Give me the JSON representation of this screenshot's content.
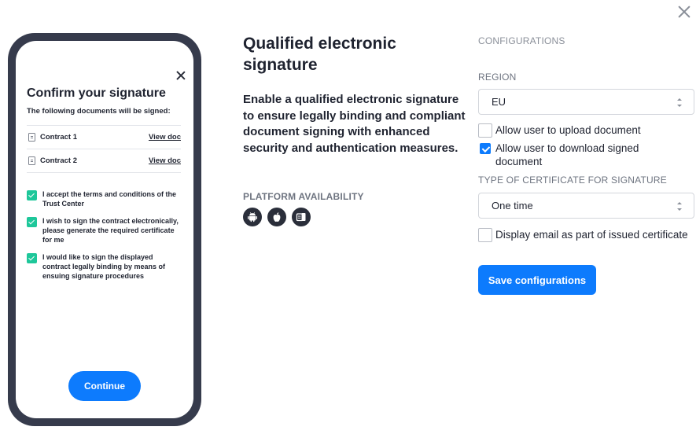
{
  "dialog": {
    "close_label": "Close"
  },
  "mobile_preview": {
    "title": "Confirm your signature",
    "subtitle": "The following documents will be signed:",
    "documents": [
      {
        "name": "Contract 1",
        "link": "View doc"
      },
      {
        "name": "Contract 2",
        "link": "View doc"
      }
    ],
    "consents": [
      {
        "text": "I accept the terms and conditions of the Trust Center",
        "checked": true
      },
      {
        "text": "I wish to sign the contract electronically, please generate the required certificate for me",
        "checked": true
      },
      {
        "text": "I would like to sign the displayed contract legally binding by means of ensuing signature procedures",
        "checked": true
      }
    ],
    "continue_label": "Continue",
    "accent_color": "#1ec79a"
  },
  "feature": {
    "title": "Qualified electronic signature",
    "description": "Enable a qualified electronic signature to ensure legally binding and compliant document signing with enhanced security and authentication measures.",
    "platform_label": "PLATFORM AVAILABILITY",
    "platforms": [
      "android-icon",
      "apple-icon",
      "web-icon"
    ]
  },
  "configurations": {
    "heading": "CONFIGURATIONS",
    "region_label": "REGION",
    "region_value": "EU",
    "allow_upload_label": "Allow user to upload document",
    "allow_upload_checked": false,
    "allow_download_label": "Allow user to download signed document",
    "allow_download_checked": true,
    "certificate_type_label": "TYPE OF CERTIFICATE FOR SIGNATURE",
    "certificate_type_value": "One time",
    "display_email_label": "Display email as part of issued certificate",
    "display_email_checked": false,
    "save_label": "Save configurations"
  },
  "colors": {
    "primary": "#0d7bfd",
    "dark": "#1f2330",
    "phone_frame": "#363b4c"
  }
}
